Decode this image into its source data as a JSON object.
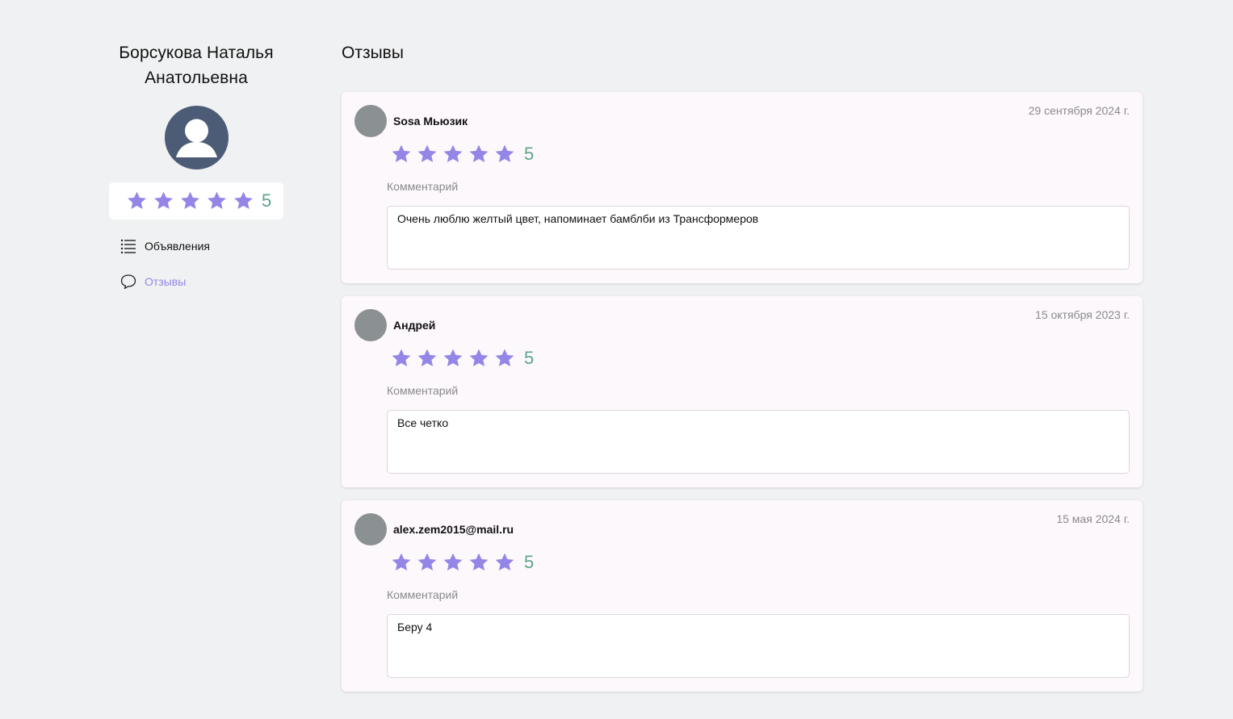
{
  "profile": {
    "name": "Борсукова Наталья Анатольевна",
    "rating": "5",
    "stars": 5
  },
  "nav": {
    "items": [
      {
        "label": "Объявления",
        "icon": "list-icon",
        "active": false
      },
      {
        "label": "Отзывы",
        "icon": "comment-icon",
        "active": true
      }
    ]
  },
  "main": {
    "title": "Отзывы"
  },
  "reviews": [
    {
      "author": "Sosa Мьюзик",
      "date": "29 сентября 2024 г.",
      "rating": "5",
      "comment_label": "Комментарий",
      "comment": "Очень люблю желтый цвет, напоминает бамблби из Трансформеров"
    },
    {
      "author": "Андрей",
      "date": "15 октября 2023 г.",
      "rating": "5",
      "comment_label": "Комментарий",
      "comment": "Все четко"
    },
    {
      "author": "alex.zem2015@mail.ru",
      "date": "15 мая 2024 г.",
      "rating": "5",
      "comment_label": "Комментарий",
      "comment": "Беру 4"
    }
  ],
  "colors": {
    "star": "#9486e6",
    "rating_number": "#5aa58a",
    "active_nav": "#9486e6",
    "avatar": "#4c5c77",
    "reviewer_avatar": "#8b9093"
  }
}
